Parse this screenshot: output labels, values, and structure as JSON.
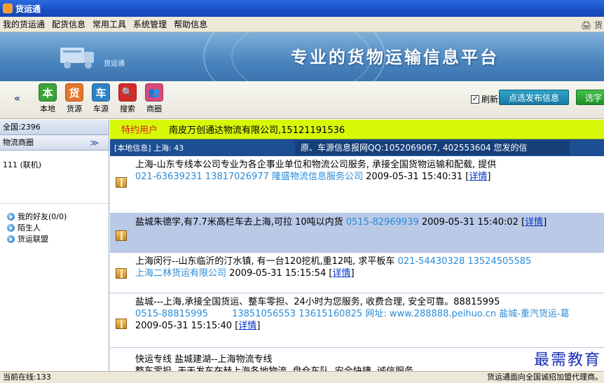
{
  "window": {
    "title": "货运通"
  },
  "menu": {
    "items": [
      "我的货运通",
      "配货信息",
      "常用工具",
      "系统管理",
      "帮助信息"
    ],
    "right_text": "🖨 货"
  },
  "banner": {
    "logo_text": "货运通",
    "slogan": "专业的货物运输信息平台"
  },
  "toolbar": {
    "collapse": "«",
    "tools": [
      {
        "glyph": "本",
        "label": "本地",
        "color": "#3aa339"
      },
      {
        "glyph": "货",
        "label": "货源",
        "color": "#e6762a"
      },
      {
        "glyph": "车",
        "label": "车源",
        "color": "#2e82c6"
      },
      {
        "glyph": "🔍",
        "label": "搜索",
        "color": "#d62a2a"
      },
      {
        "glyph": "👥",
        "label": "商圈",
        "color": "#d94a7a"
      }
    ],
    "refresh_label": "刷新",
    "refresh_checked": "✓",
    "publish_label": "点选发布信息",
    "pick_label": "选字"
  },
  "sidebar": {
    "total": "全国:2396",
    "circle_title": "物流商圈",
    "circle_chevron": "≫",
    "online_group": "111 (联机)",
    "friends": [
      "我的好友(0/0)",
      "陌生人",
      "货运联盟"
    ]
  },
  "content": {
    "vip_tag": "特约用户",
    "vip_text": "南皮万创通达物流有限公司,15121191536",
    "local_info": "[本地信息] 上海: 43",
    "marquee": "原、车源信息报网QQ:1052069067, 402553604 您发的信",
    "rows": [
      {
        "line1": "上海-山东专线本公司专业为各企事业单位和物流公司服务, 承接全国货物运输和配载, 提供",
        "phone": "021-63639231 13817026977",
        "company": "隆盛物流信息服务公司",
        "time": "2009-05-31 15:40:31",
        "detail": "详情"
      },
      {
        "line1": "盐城朱德学,有7.7米高栏车去上海,可拉 10吨以内货",
        "phone": "0515-82969939",
        "time": "2009-05-31 15:40:02",
        "detail": "详情"
      },
      {
        "line1": "上海闵行--山东临沂的汀水镇, 有一台120挖机,重12吨, 求平板车",
        "phone": "021-54430328 13524505585",
        "company": "上海二林货运有限公司",
        "time": "2009-05-31 15:15:54",
        "detail": "详情"
      },
      {
        "line1": "盐城---上海,承接全国货运、整车零担、24小时为您服务, 收费合理, 安全可靠。88815995",
        "phone": "0515-88815995",
        "phone2": "13851056553 13615160825",
        "web_label": "网址:",
        "web": "www.288888.peihuo.cn",
        "company": "盐城-重汽货运-葛",
        "time": "2009-05-31 15:15:40",
        "detail": "详情"
      },
      {
        "line1": "快运专线 盐城建湖--上海物流专线",
        "line2": "整车零担, 天天发车在赫上海各地物流, 盘仓车队, 安全快捷, 诚信服务"
      }
    ],
    "watermark": "最需教育"
  },
  "status": {
    "online": "当前在线:133",
    "right": "货运通面向全国诚招加盟代理商。"
  }
}
